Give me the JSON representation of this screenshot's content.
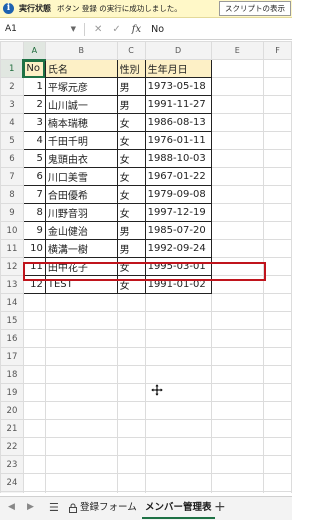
{
  "infobar": {
    "title": "実行状態",
    "message": "ボタン 登録 の実行に成功しました。",
    "script_button": "スクリプトの表示"
  },
  "formula_bar": {
    "name_box": "A1",
    "formula": "No"
  },
  "columns": [
    "A",
    "B",
    "C",
    "D",
    "E",
    "F"
  ],
  "active_column": "A",
  "active_row": 1,
  "table": {
    "headers": [
      "No",
      "氏名",
      "性別",
      "生年月日"
    ],
    "rows": [
      [
        "1",
        "平塚元彦",
        "男",
        "1973-05-18"
      ],
      [
        "2",
        "山川誠一",
        "男",
        "1991-11-27"
      ],
      [
        "3",
        "楠本瑞穂",
        "女",
        "1986-08-13"
      ],
      [
        "4",
        "千田千明",
        "女",
        "1976-01-11"
      ],
      [
        "5",
        "鬼頭由衣",
        "女",
        "1988-10-03"
      ],
      [
        "6",
        "川口美雪",
        "女",
        "1967-01-22"
      ],
      [
        "7",
        "合田優希",
        "女",
        "1979-09-08"
      ],
      [
        "8",
        "川野音羽",
        "女",
        "1997-12-19"
      ],
      [
        "9",
        "金山健治",
        "男",
        "1985-07-20"
      ],
      [
        "10",
        "横溝一樹",
        "男",
        "1992-09-24"
      ],
      [
        "11",
        "田中花子",
        "女",
        "1995-03-01"
      ],
      [
        "12",
        "TEST",
        "女",
        "1991-01-02"
      ]
    ]
  },
  "visible_row_count": 25,
  "highlight_row": 13,
  "colors": {
    "header_fill": "#fdf0c6",
    "highlight_border": "#c0141c",
    "accent_green": "#1e7145",
    "infobar_bg": "#fff8c8"
  },
  "sheet_tabs": {
    "form_tab": "登録フォーム",
    "members_tab": "メンバー管理表",
    "active": "メンバー管理表"
  },
  "icons": {
    "info": "info-icon",
    "cancel": "close-icon",
    "confirm": "check-icon",
    "fx": "fx-icon",
    "sheets_list": "menu-icon",
    "lock": "lock-icon",
    "add_sheet": "plus-icon",
    "cursor": "move-cursor-icon"
  }
}
